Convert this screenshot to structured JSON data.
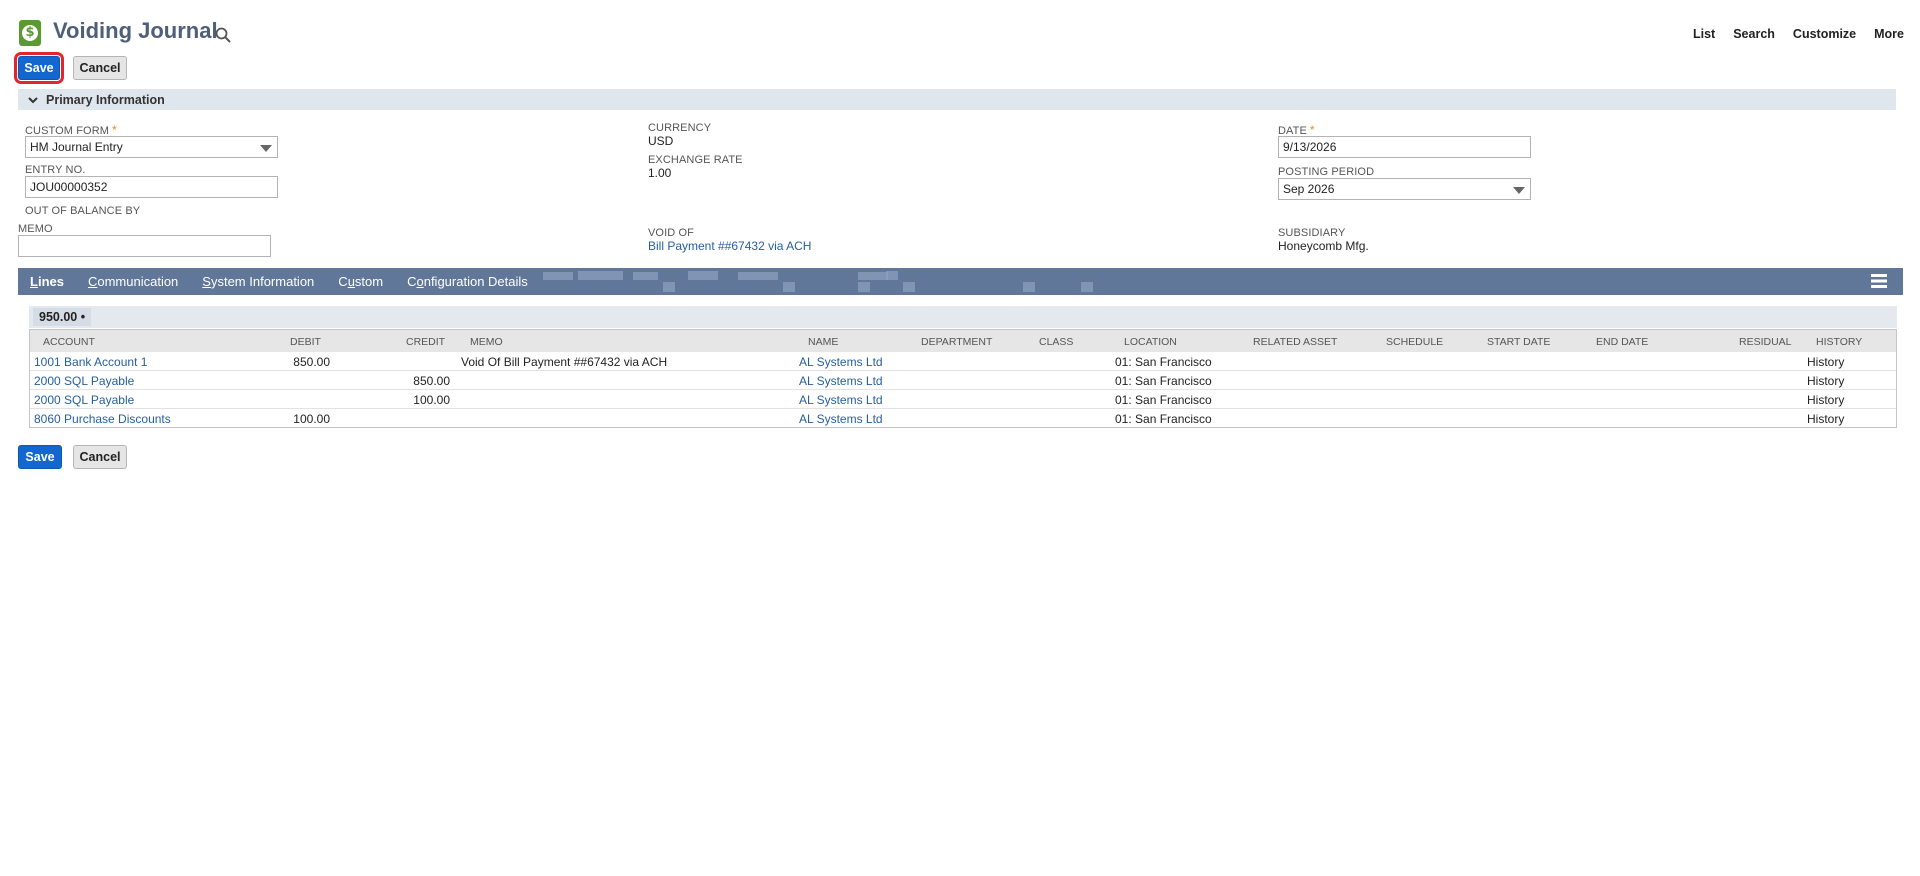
{
  "header": {
    "title": "Voiding Journal",
    "nav": [
      "List",
      "Search",
      "Customize",
      "More"
    ]
  },
  "buttons": {
    "save": "Save",
    "cancel": "Cancel"
  },
  "primary_info": {
    "section_label": "Primary Information",
    "custom_form": {
      "label": "CUSTOM FORM",
      "value": "HM Journal Entry"
    },
    "entry_no": {
      "label": "ENTRY NO.",
      "value": "JOU00000352"
    },
    "out_of_balance": {
      "label": "OUT OF BALANCE BY"
    },
    "memo": {
      "label": "MEMO",
      "value": ""
    },
    "currency": {
      "label": "CURRENCY",
      "value": "USD"
    },
    "exchange_rate": {
      "label": "EXCHANGE RATE",
      "value": "1.00"
    },
    "void_of": {
      "label": "VOID OF",
      "value": "Bill Payment ##67432 via ACH"
    },
    "date": {
      "label": "DATE",
      "value": "9/13/2026"
    },
    "posting_period": {
      "label": "POSTING PERIOD",
      "value": "Sep 2026"
    },
    "subsidiary": {
      "label": "SUBSIDIARY",
      "value": "Honeycomb Mfg."
    }
  },
  "tabs": [
    {
      "pre": "",
      "key": "L",
      "post": "ines"
    },
    {
      "pre": "",
      "key": "C",
      "post": "ommunication"
    },
    {
      "pre": "",
      "key": "S",
      "post": "ystem Information"
    },
    {
      "pre": "C",
      "key": "u",
      "post": "stom"
    },
    {
      "pre": "C",
      "key": "o",
      "post": "nfiguration Details"
    }
  ],
  "lines": {
    "total": "950.00 •",
    "columns": [
      "ACCOUNT",
      "DEBIT",
      "CREDIT",
      "MEMO",
      "NAME",
      "DEPARTMENT",
      "CLASS",
      "LOCATION",
      "RELATED ASSET",
      "SCHEDULE",
      "START DATE",
      "END DATE",
      "RESIDUAL",
      "HISTORY"
    ],
    "rows": [
      {
        "account": "1001 Bank Account 1",
        "debit": "850.00",
        "credit": "",
        "memo": "Void Of Bill Payment ##67432 via ACH",
        "name": "AL Systems Ltd",
        "location": "01: San Francisco",
        "history": "History"
      },
      {
        "account": "2000 SQL Payable",
        "debit": "",
        "credit": "850.00",
        "memo": "",
        "name": "AL Systems Ltd",
        "location": "01: San Francisco",
        "history": "History"
      },
      {
        "account": "2000 SQL Payable",
        "debit": "",
        "credit": "100.00",
        "memo": "",
        "name": "AL Systems Ltd",
        "location": "01: San Francisco",
        "history": "History"
      },
      {
        "account": "8060 Purchase Discounts",
        "debit": "100.00",
        "credit": "",
        "memo": "",
        "name": "AL Systems Ltd",
        "location": "01: San Francisco",
        "history": "History"
      }
    ]
  },
  "colors": {
    "primary_button": "#1467cf",
    "tab_bar": "#607799",
    "link": "#255fa0",
    "required": "#f18a1a",
    "focus_outline": "#e1262d"
  }
}
